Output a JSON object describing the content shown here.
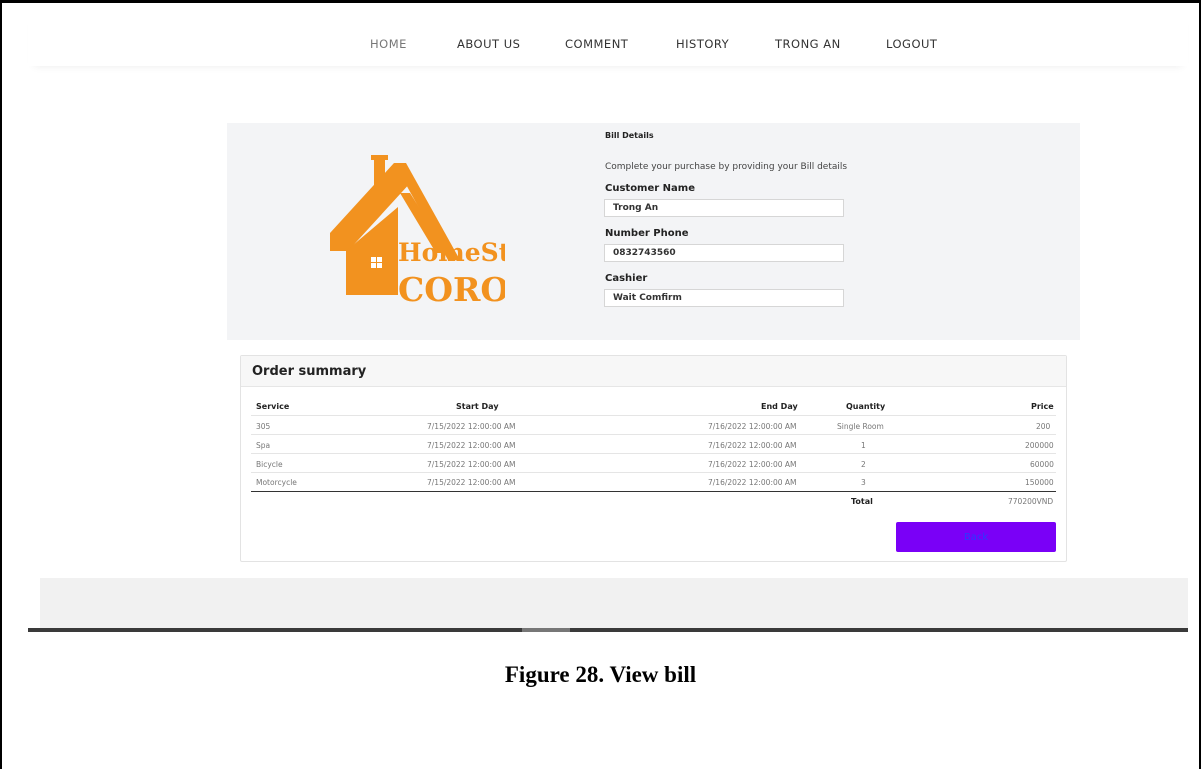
{
  "nav": {
    "items": [
      "HOME",
      "ABOUT US",
      "COMMENT",
      "HISTORY",
      "TRONG AN",
      "LOGOUT"
    ]
  },
  "logo": {
    "line1": "HomeStay",
    "line2": "CORONA",
    "color": "#f2921f"
  },
  "bill": {
    "title": "Bill Details",
    "description": "Complete your purchase by providing your Bill details",
    "fields": [
      {
        "label": "Customer Name",
        "value": "Trong An"
      },
      {
        "label": "Number Phone",
        "value": "0832743560"
      },
      {
        "label": "Cashier",
        "value": "Wait Comfirm"
      }
    ]
  },
  "summary": {
    "title": "Order summary",
    "headers": [
      "Service",
      "Start Day",
      "End Day",
      "Quantity",
      "Price"
    ],
    "rows": [
      [
        "305",
        "7/15/2022 12:00:00 AM",
        "7/16/2022 12:00:00 AM",
        "Single Room",
        "200"
      ],
      [
        "Spa",
        "7/15/2022 12:00:00 AM",
        "7/16/2022 12:00:00 AM",
        "1",
        "200000"
      ],
      [
        "Bicycle",
        "7/15/2022 12:00:00 AM",
        "7/16/2022 12:00:00 AM",
        "2",
        "60000"
      ],
      [
        "Motorcycle",
        "7/15/2022 12:00:00 AM",
        "7/16/2022 12:00:00 AM",
        "3",
        "150000"
      ]
    ],
    "total_label": "Total",
    "total_value": "770200VND",
    "back_label": "Back"
  },
  "caption": "Figure 28. View bill",
  "colors": {
    "accent_button": "#7a00f7",
    "panel_bg": "#f3f4f6"
  }
}
